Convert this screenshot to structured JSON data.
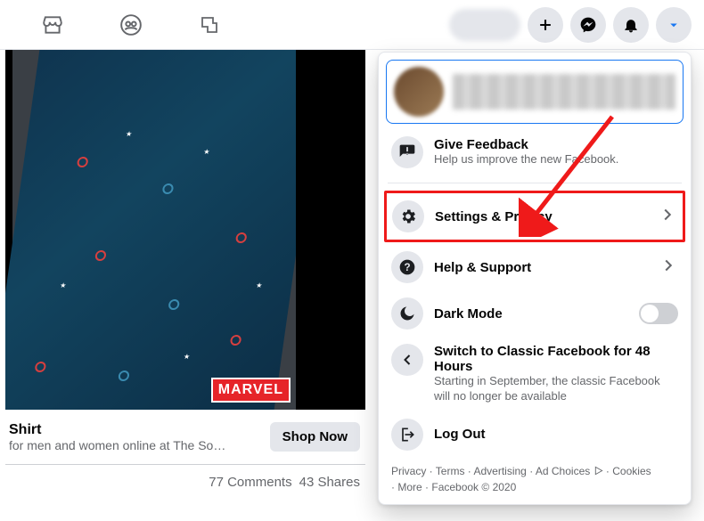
{
  "topbar": {
    "nav": {
      "marketplace": "Marketplace",
      "groups": "Groups",
      "gaming": "Gaming"
    },
    "actions": {
      "create": "Create",
      "messenger": "Messenger",
      "notifications": "Notifications",
      "account": "Account"
    }
  },
  "feed": {
    "product": {
      "badge": "MARVEL",
      "title": "Shirt",
      "subtitle": "for men and women online at The So…",
      "cta": "Shop Now"
    },
    "engagement": {
      "comments": "77 Comments",
      "shares": "43 Shares"
    }
  },
  "dropdown": {
    "feedback": {
      "title": "Give Feedback",
      "subtitle": "Help us improve the new Facebook."
    },
    "settings": {
      "title": "Settings & Privacy"
    },
    "help": {
      "title": "Help & Support"
    },
    "dark": {
      "title": "Dark Mode"
    },
    "classic": {
      "title": "Switch to Classic Facebook for 48 Hours",
      "subtitle": "Starting in September, the classic Facebook will no longer be available"
    },
    "logout": {
      "title": "Log Out"
    },
    "footer": {
      "privacy": "Privacy",
      "terms": "Terms",
      "advertising": "Advertising",
      "adchoices": "Ad Choices",
      "cookies": "Cookies",
      "more": "More",
      "copyright": "Facebook © 2020"
    }
  }
}
